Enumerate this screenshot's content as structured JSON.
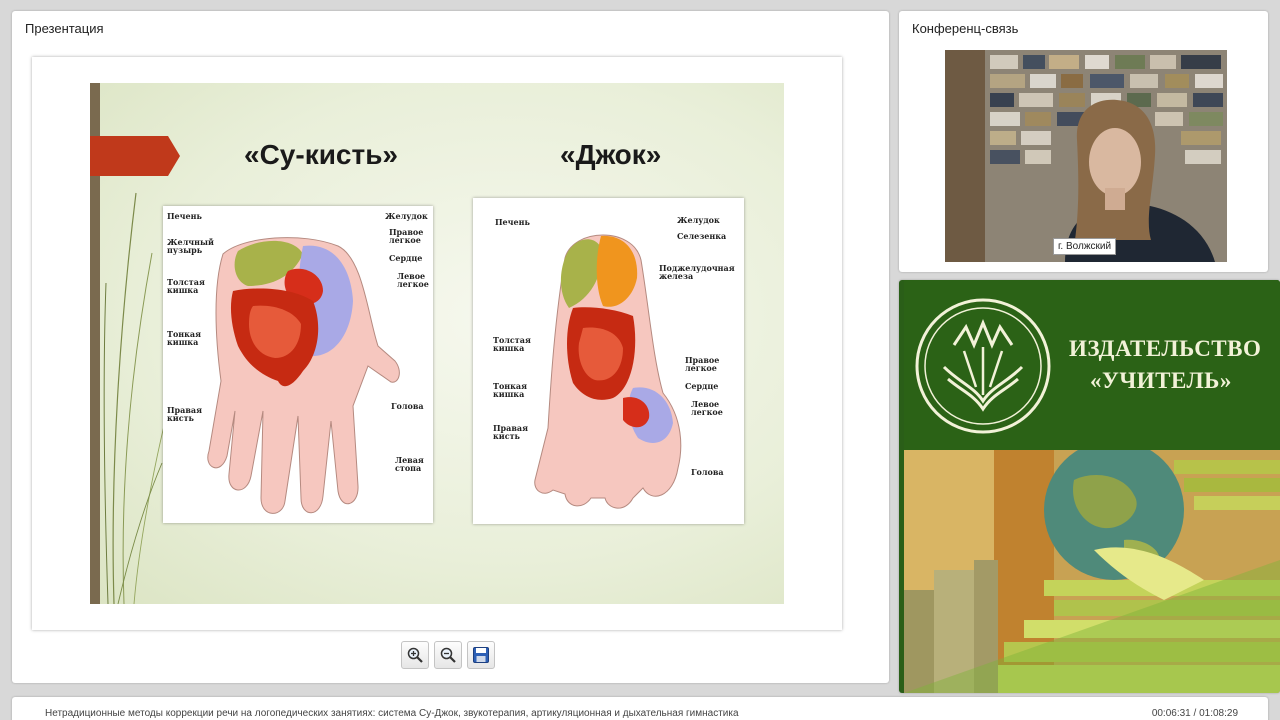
{
  "presentation": {
    "title": "Презентация",
    "slide": {
      "title_left": "«Су-кисть»",
      "title_right": "«Джок»",
      "hand_labels": {
        "liver": "Печень",
        "gallbladder": "Желчный\nпузырь",
        "large_intestine": "Толстая\nкишка",
        "small_intestine": "Тонкая\nкишка",
        "right_hand": "Правая\nкисть",
        "stomach": "Желудок",
        "right_lung": "Правое\nлегкое",
        "heart": "Сердце",
        "left_lung": "Левое\nлегкое",
        "head": "Голова",
        "left_foot": "Левая\nстопа"
      },
      "foot_labels": {
        "liver": "Печень",
        "large_intestine": "Толстая\nкишка",
        "small_intestine": "Тонкая\nкишка",
        "right_hand": "Правая\nкисть",
        "stomach": "Желудок",
        "spleen": "Селезенка",
        "pancreas": "Поджелудочная\nжелеза",
        "right_lung": "Правое\nлегкое",
        "heart": "Сердце",
        "left_lung": "Левое\nлегкое",
        "head": "Голова"
      }
    },
    "toolbar": {
      "zoom_in_icon": "zoom-in-icon",
      "zoom_out_icon": "zoom-out-icon",
      "save_icon": "save-icon"
    }
  },
  "conference": {
    "title": "Конференц-связь",
    "location": "г. Волжский"
  },
  "ad": {
    "line1": "ИЗДАТЕЛЬСТВО",
    "line2": "«УЧИТЕЛЬ»"
  },
  "status": {
    "course_title": "Нетрадиционные методы коррекции речи на логопедических занятиях: система Су-Джок, звукотерапия, артикуляционная и дыхательная гимнастика",
    "time": "00:06:31 / 01:08:29"
  },
  "colors": {
    "accent_arrow": "#c0391b",
    "ad_green": "#2b6216",
    "ad_text": "#f2f2d8"
  }
}
